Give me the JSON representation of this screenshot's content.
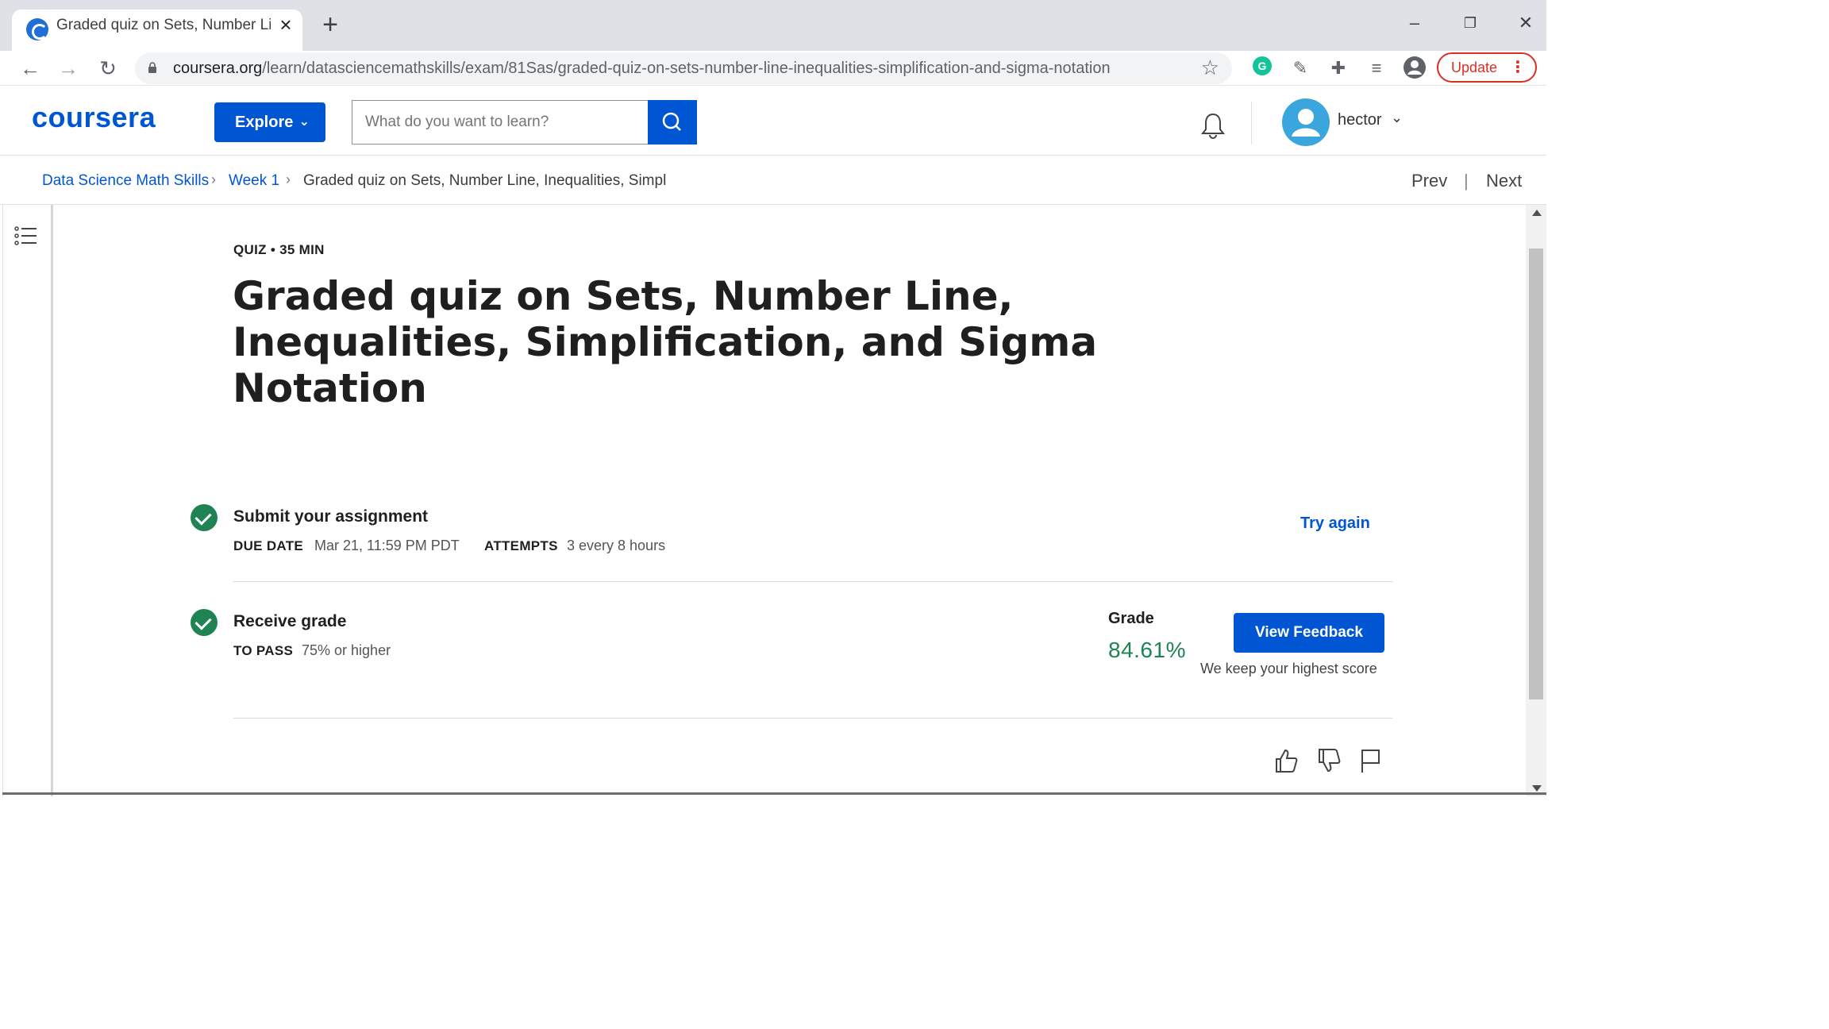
{
  "browser": {
    "tab_title": "Graded quiz on Sets, Number Line, Inequalities",
    "url_host": "coursera.org",
    "url_path": "/learn/datasciencemathskills/exam/81Sas/graded-quiz-on-sets-number-line-inequalities-simplification-and-sigma-notation",
    "update_label": "Update"
  },
  "header": {
    "logo": "coursera",
    "explore_label": "Explore",
    "search_placeholder": "What do you want to learn?",
    "username": "hector"
  },
  "breadcrumb": {
    "items": [
      "Data Science Math Skills",
      "Week 1",
      "Graded quiz on Sets, Number Line, Inequalities, Simpl"
    ],
    "prev_label": "Prev",
    "next_label": "Next"
  },
  "quiz": {
    "meta": "QUIZ • 35 MIN",
    "title": "Graded quiz on Sets, Number Line, Inequalities, Simplification, and Sigma Notation",
    "submit": {
      "title": "Submit your assignment",
      "due_label": "DUE DATE",
      "due_value": "Mar 21, 11:59 PM PDT",
      "attempts_label": "ATTEMPTS",
      "attempts_value": "3 every 8 hours",
      "try_again_label": "Try again"
    },
    "receive": {
      "title": "Receive grade",
      "to_pass_label": "TO PASS",
      "to_pass_value": "75% or higher",
      "grade_label": "Grade",
      "grade_value": "84.61%",
      "view_feedback_label": "View Feedback",
      "keep_note": "We keep your highest score"
    }
  },
  "colors": {
    "brand_blue": "#0056d2",
    "success_green": "#1f8354",
    "update_red": "#d93025"
  },
  "icons": [
    "coursera-favicon-icon",
    "close-icon",
    "plus-icon",
    "back-icon",
    "forward-icon",
    "reload-icon",
    "lock-icon",
    "star-icon",
    "grammarly-icon",
    "eyedropper-icon",
    "puzzle-icon",
    "media-icon",
    "profile-icon",
    "search-icon",
    "bell-icon",
    "avatar-icon",
    "chevron-down-icon",
    "outline-icon",
    "check-icon",
    "thumbs-up-icon",
    "thumbs-down-icon",
    "flag-icon"
  ]
}
